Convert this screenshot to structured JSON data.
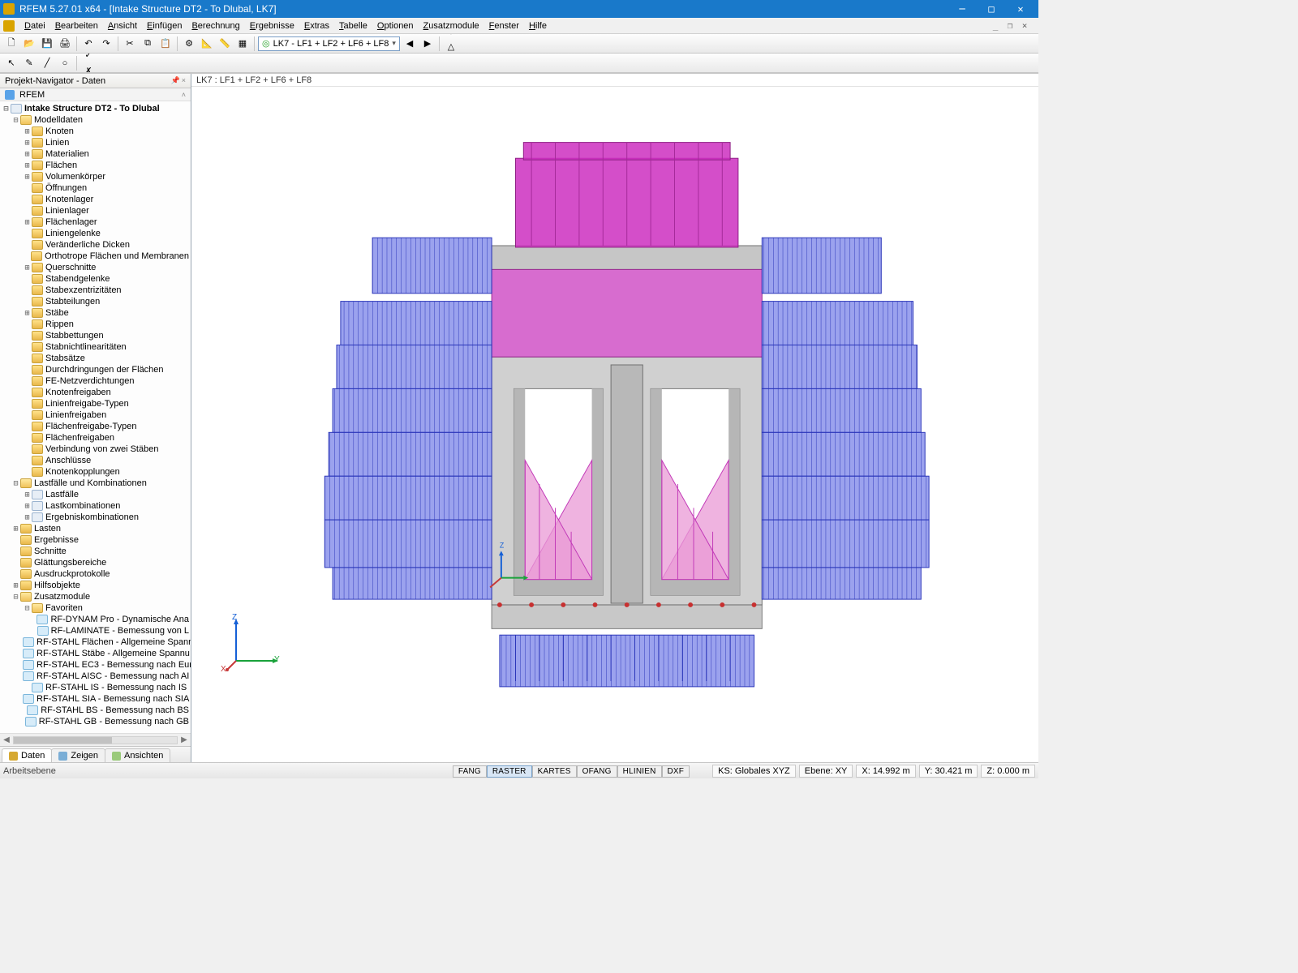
{
  "title": "RFEM 5.27.01 x64 - [Intake Structure DT2 - To Dlubal, LK7]",
  "menus": [
    "Datei",
    "Bearbeiten",
    "Ansicht",
    "Einfügen",
    "Berechnung",
    "Ergebnisse",
    "Extras",
    "Tabelle",
    "Optionen",
    "Zusatzmodule",
    "Fenster",
    "Hilfe"
  ],
  "loadcase_combo": "LK7 - LF1 + LF2 + LF6 + LF8",
  "navigator": {
    "title": "Projekt-Navigator - Daten",
    "root": "RFEM",
    "model": "Intake Structure DT2 - To Dlubal",
    "modelldaten": "Modelldaten",
    "modelldaten_children": [
      "Knoten",
      "Linien",
      "Materialien",
      "Flächen",
      "Volumenkörper",
      "Öffnungen",
      "Knotenlager",
      "Linienlager",
      "Flächenlager",
      "Liniengelenke",
      "Veränderliche Dicken",
      "Orthotrope Flächen und Membranen",
      "Querschnitte",
      "Stabendgelenke",
      "Stabexzentrizitäten",
      "Stabteilungen",
      "Stäbe",
      "Rippen",
      "Stabbettungen",
      "Stabnichtlinearitäten",
      "Stabsätze",
      "Durchdringungen der Flächen",
      "FE-Netzverdichtungen",
      "Knotenfreigaben",
      "Linienfreigabe-Typen",
      "Linienfreigaben",
      "Flächenfreigabe-Typen",
      "Flächenfreigaben",
      "Verbindung von zwei Stäben",
      "Anschlüsse",
      "Knotenkopplungen"
    ],
    "expand_plus": [
      "Knoten",
      "Linien",
      "Materialien",
      "Flächen",
      "Volumenkörper",
      "Flächenlager",
      "Querschnitte",
      "Stäbe"
    ],
    "lastfaelle_kombi": "Lastfälle und Kombinationen",
    "lastfaelle_children": [
      "Lastfälle",
      "Lastkombinationen",
      "Ergebniskombinationen"
    ],
    "other_sections": [
      "Lasten",
      "Ergebnisse",
      "Schnitte",
      "Glättungsbereiche",
      "Ausdruckprotokolle"
    ],
    "hilfsobjekte": "Hilfsobjekte",
    "zusatzmodule": "Zusatzmodule",
    "favoriten": "Favoriten",
    "fav_items": [
      "RF-DYNAM Pro - Dynamische Ana",
      "RF-LAMINATE - Bemessung von L"
    ],
    "stahl_items": [
      "RF-STAHL Flächen - Allgemeine Spann",
      "RF-STAHL Stäbe - Allgemeine Spannu",
      "RF-STAHL EC3 - Bemessung nach Eur",
      "RF-STAHL AISC - Bemessung nach AI",
      "RF-STAHL IS - Bemessung nach IS",
      "RF-STAHL SIA - Bemessung nach SIA",
      "RF-STAHL BS - Bemessung nach BS",
      "RF-STAHL GB - Bemessung nach GB"
    ],
    "tabs": [
      "Daten",
      "Zeigen",
      "Ansichten"
    ]
  },
  "viewport_header": "LK7 : LF1 + LF2 + LF6 + LF8",
  "axes": {
    "x": "X",
    "y": "Y",
    "z": "Z"
  },
  "status": {
    "left": "Arbeitsebene",
    "buttons": [
      "FANG",
      "RASTER",
      "KARTES",
      "OFANG",
      "HLINIEN",
      "DXF"
    ],
    "active": "RASTER",
    "cs": "KS: Globales XYZ",
    "plane": "Ebene: XY",
    "x": "X: 14.992 m",
    "y": "Y: 30.421 m",
    "z": "Z: 0.000 m"
  },
  "colors": {
    "load_blue": "#3a49d6",
    "load_magenta": "#c23ab8",
    "load_pink": "#e99ad6",
    "concrete": "#bfbfbf",
    "concrete_dark": "#8e8e8e"
  }
}
